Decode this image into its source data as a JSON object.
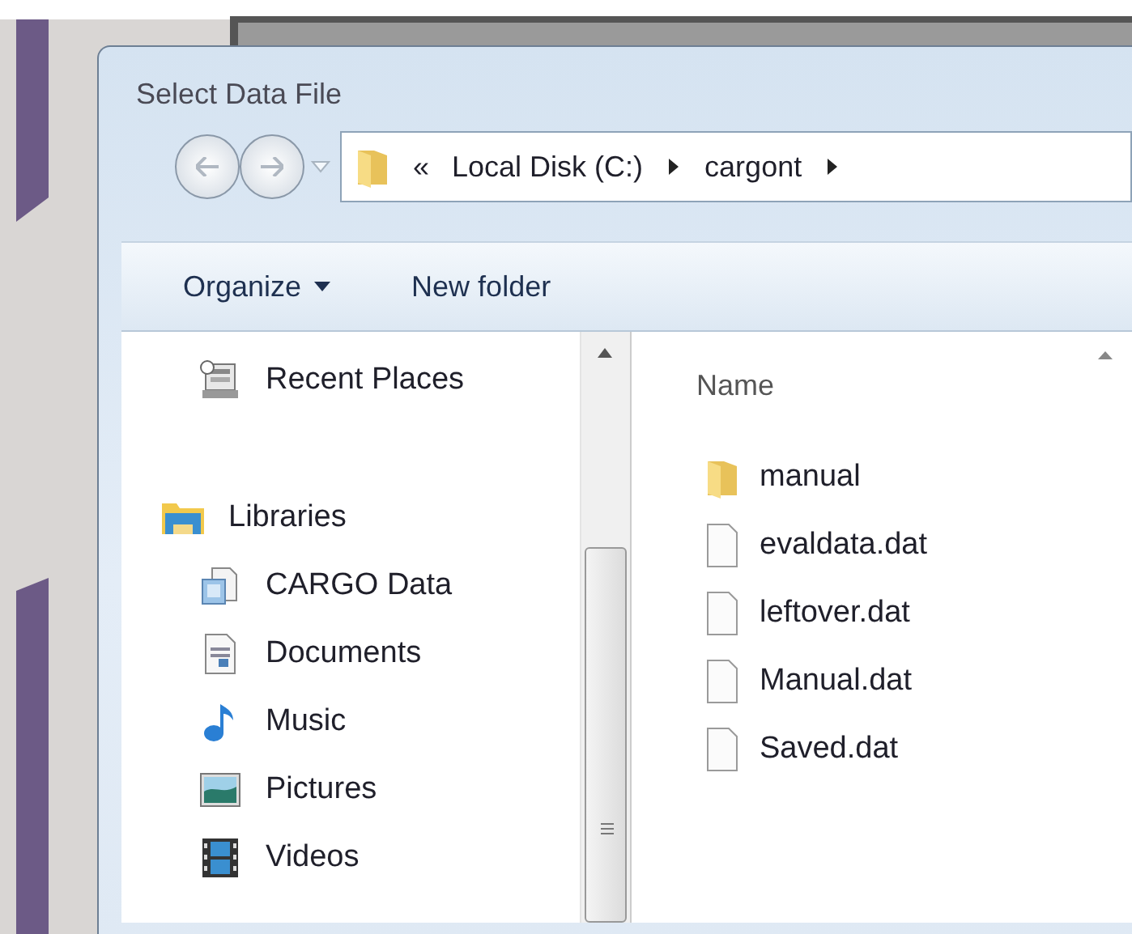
{
  "window": {
    "title": "Select Data File"
  },
  "address_bar": {
    "overflow": "«",
    "path": [
      {
        "label": "Local Disk (C:)"
      },
      {
        "label": "cargont"
      }
    ]
  },
  "toolbar": {
    "items": [
      {
        "label": "Organize",
        "kind": "menu"
      },
      {
        "label": "New folder",
        "kind": "button"
      }
    ]
  },
  "nav_pane": {
    "items": [
      {
        "label": "Recent Places",
        "kind": "recent"
      },
      {
        "label": "Libraries",
        "kind": "libraries",
        "children": [
          {
            "label": "CARGO Data",
            "kind": "library"
          },
          {
            "label": "Documents",
            "kind": "documents"
          },
          {
            "label": "Music",
            "kind": "music"
          },
          {
            "label": "Pictures",
            "kind": "pictures"
          },
          {
            "label": "Videos",
            "kind": "videos"
          }
        ]
      }
    ]
  },
  "file_list": {
    "columns": [
      "Name"
    ],
    "items": [
      {
        "name": "manual",
        "kind": "folder"
      },
      {
        "name": "evaldata.dat",
        "kind": "file"
      },
      {
        "name": "leftover.dat",
        "kind": "file"
      },
      {
        "name": "Manual.dat",
        "kind": "file"
      },
      {
        "name": "Saved.dat",
        "kind": "file"
      }
    ]
  }
}
